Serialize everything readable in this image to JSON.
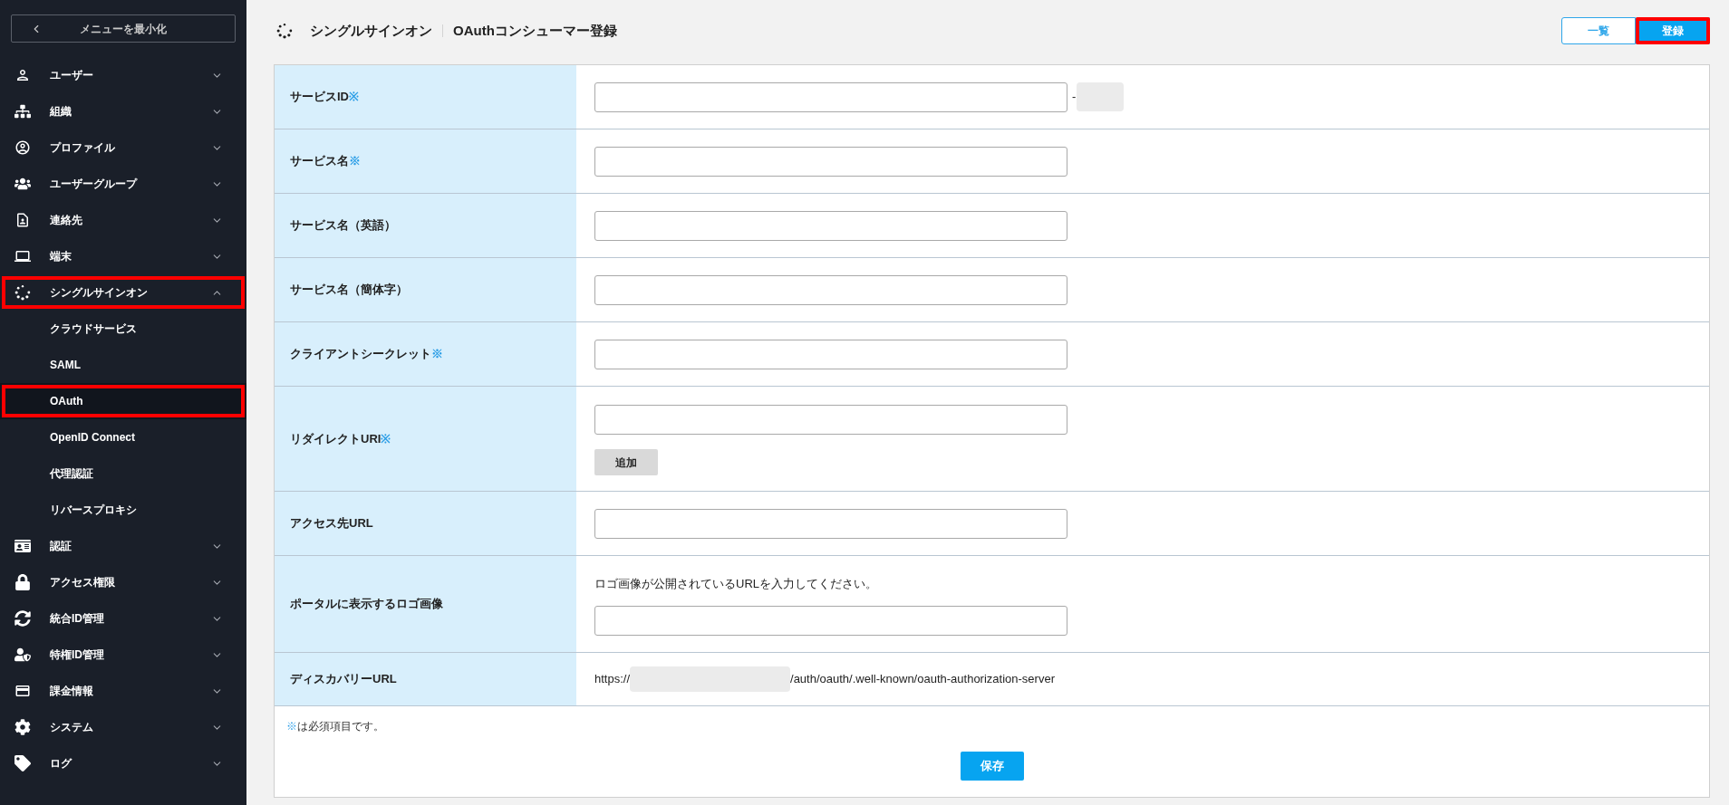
{
  "sidebar": {
    "collapse_button": "メニューを最小化",
    "items": [
      {
        "label": "ユーザー",
        "expanded": false,
        "highlighted": false
      },
      {
        "label": "組織",
        "expanded": false,
        "highlighted": false
      },
      {
        "label": "プロファイル",
        "expanded": false,
        "highlighted": false
      },
      {
        "label": "ユーザーグループ",
        "expanded": false,
        "highlighted": false
      },
      {
        "label": "連絡先",
        "expanded": false,
        "highlighted": false
      },
      {
        "label": "端末",
        "expanded": false,
        "highlighted": false
      },
      {
        "label": "シングルサインオン",
        "expanded": true,
        "highlighted": true,
        "children": [
          {
            "label": "クラウドサービス",
            "selected": false,
            "highlighted": false
          },
          {
            "label": "SAML",
            "selected": false,
            "highlighted": false
          },
          {
            "label": "OAuth",
            "selected": true,
            "highlighted": true
          },
          {
            "label": "OpenID Connect",
            "selected": false,
            "highlighted": false
          },
          {
            "label": "代理認証",
            "selected": false,
            "highlighted": false
          },
          {
            "label": "リバースプロキシ",
            "selected": false,
            "highlighted": false
          }
        ]
      },
      {
        "label": "認証",
        "expanded": false,
        "highlighted": false
      },
      {
        "label": "アクセス権限",
        "expanded": false,
        "highlighted": false
      },
      {
        "label": "統合ID管理",
        "expanded": false,
        "highlighted": false
      },
      {
        "label": "特権ID管理",
        "expanded": false,
        "highlighted": false
      },
      {
        "label": "課金情報",
        "expanded": false,
        "highlighted": false
      },
      {
        "label": "システム",
        "expanded": false,
        "highlighted": false
      },
      {
        "label": "ログ",
        "expanded": false,
        "highlighted": false
      }
    ]
  },
  "header": {
    "section": "シングルサインオン",
    "title": "OAuthコンシューマー登録",
    "buttons": [
      {
        "label": "一覧",
        "kind": "outline",
        "highlighted": false
      },
      {
        "label": "登録",
        "kind": "primary",
        "highlighted": true
      }
    ]
  },
  "form": {
    "rows": [
      {
        "label": "サービスID",
        "required_mark": "※",
        "kind": "input_suffix",
        "suffix": "-"
      },
      {
        "label": "サービス名",
        "required_mark": "※",
        "kind": "input"
      },
      {
        "label": "サービス名（英語）",
        "kind": "input"
      },
      {
        "label": "サービス名（簡体字）",
        "kind": "input"
      },
      {
        "label": "クライアントシークレット",
        "required_mark": "※",
        "kind": "input"
      },
      {
        "label": "リダイレクトURI",
        "required_mark": "※",
        "kind": "input_add",
        "button": "追加"
      },
      {
        "label": "アクセス先URL",
        "kind": "input"
      },
      {
        "label": "ポータルに表示するロゴ画像",
        "kind": "help_input",
        "help": "ロゴ画像が公開されているURLを入力してください。"
      },
      {
        "label": "ディスカバリーURL",
        "kind": "url",
        "prefix": "https://",
        "suffix": "/auth/oauth/.well-known/oauth-authorization-server"
      }
    ],
    "note": {
      "mark": "※",
      "text": "は必須項目です。"
    },
    "save_button": "保存"
  }
}
